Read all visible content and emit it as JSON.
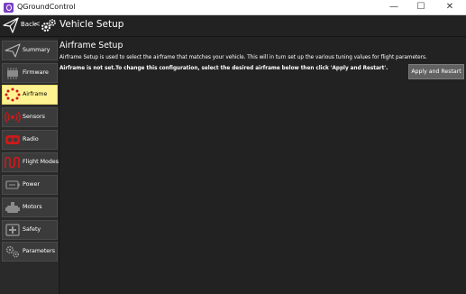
{
  "window": {
    "title": "QGroundControl",
    "minimize_glyph": "—",
    "maximize_glyph": "☐",
    "close_glyph": "✕"
  },
  "toolbar": {
    "back_label": "Back",
    "back_chevron": "<",
    "title": "Vehicle Setup"
  },
  "sidebar": {
    "items": [
      {
        "label": "Summary",
        "icon": "plane-icon"
      },
      {
        "label": "Firmware",
        "icon": "firmware-icon"
      },
      {
        "label": "Airframe",
        "icon": "airframe-icon",
        "active": true
      },
      {
        "label": "Sensors",
        "icon": "sensors-icon"
      },
      {
        "label": "Radio",
        "icon": "radio-icon"
      },
      {
        "label": "Flight Modes",
        "icon": "flight-modes-icon"
      },
      {
        "label": "Power",
        "icon": "power-icon"
      },
      {
        "label": "Motors",
        "icon": "motors-icon"
      },
      {
        "label": "Safety",
        "icon": "safety-icon"
      },
      {
        "label": "Parameters",
        "icon": "parameters-icon"
      }
    ]
  },
  "main": {
    "heading": "Airframe Setup",
    "description": "Airframe Setup is used to select the airframe that matches your vehicle. This will in turn set up the various tuning values for flight parameters.",
    "warning": "Airframe is not set.To change this configuration, select the desired airframe below then click 'Apply and Restart'.",
    "apply_button": "Apply and Restart"
  },
  "colors": {
    "background": "#222222",
    "active_item": "#fff291",
    "warning_red": "#cc1a1a"
  }
}
